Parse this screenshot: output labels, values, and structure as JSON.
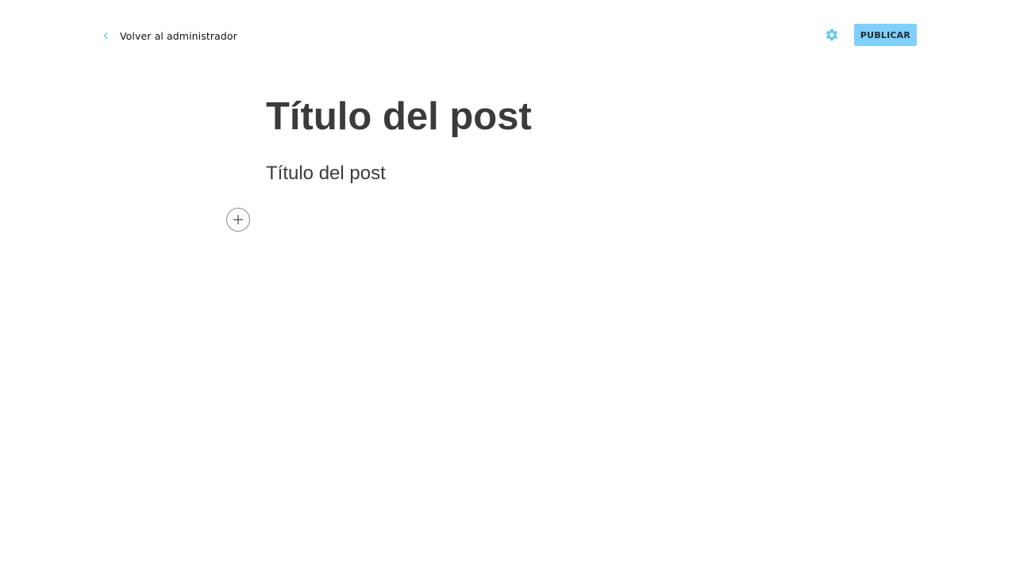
{
  "header": {
    "back_label": "Volver al administrador",
    "back_icon": "chevron-left-icon",
    "settings_icon": "gear-icon",
    "publish_label": "PUBLICAR"
  },
  "editor": {
    "title": "Título del post",
    "subtitle": "Título del post",
    "add_icon": "plus-icon"
  },
  "colors": {
    "accent": "#5bc8f5",
    "publish_bg": "#7fd0fb",
    "text": "#3b3b3b"
  }
}
